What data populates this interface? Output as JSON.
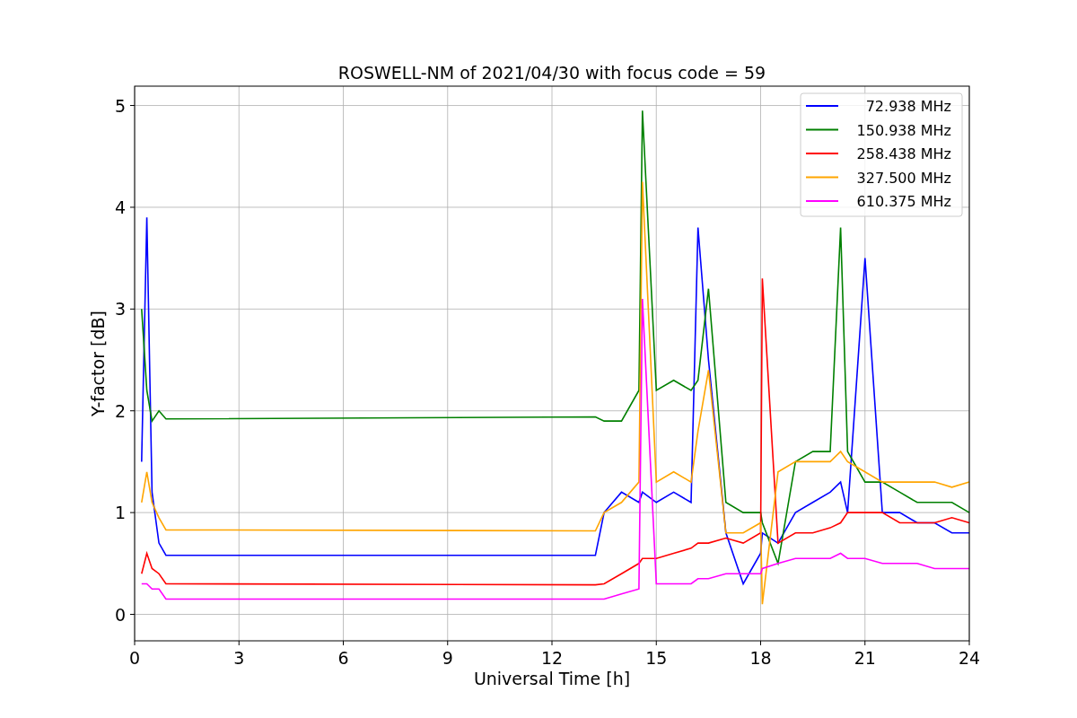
{
  "figure": {
    "chart_data": {
      "type": "line",
      "title": "ROSWELL-NM of 2021/04/30 with focus code = 59",
      "xlabel": "Universal Time [h]",
      "ylabel": "Y-factor [dB]",
      "x": [
        0.2,
        0.35,
        0.5,
        0.7,
        0.9,
        13.25,
        13.5,
        14,
        14.5,
        14.6,
        15,
        15.5,
        16,
        16.2,
        16.5,
        17,
        17.5,
        18,
        18.05,
        18.5,
        19,
        19.5,
        20,
        20.3,
        20.5,
        21,
        21.5,
        22,
        22.5,
        23,
        23.5,
        24
      ],
      "series": [
        {
          "name": "72.938 MHz",
          "color": "#0000ff",
          "values": [
            1.5,
            3.9,
            1.2,
            0.7,
            0.58,
            0.58,
            1.0,
            1.2,
            1.1,
            1.2,
            1.1,
            1.2,
            1.1,
            3.8,
            2.5,
            0.8,
            0.3,
            0.6,
            0.8,
            0.7,
            1.0,
            1.1,
            1.2,
            1.3,
            1.0,
            3.5,
            1.0,
            1.0,
            0.9,
            0.9,
            0.8,
            0.8
          ]
        },
        {
          "name": "150.938 MHz",
          "color": "#008000",
          "values": [
            3.0,
            2.2,
            1.9,
            2.0,
            1.92,
            1.94,
            1.9,
            1.9,
            2.2,
            4.95,
            2.2,
            2.3,
            2.2,
            2.3,
            3.2,
            1.1,
            1.0,
            1.0,
            0.9,
            0.5,
            1.5,
            1.6,
            1.6,
            3.8,
            1.6,
            1.3,
            1.3,
            1.2,
            1.1,
            1.1,
            1.1,
            1.0
          ]
        },
        {
          "name": "258.438 MHz",
          "color": "#ff0000",
          "values": [
            0.4,
            0.6,
            0.45,
            0.4,
            0.3,
            0.29,
            0.3,
            0.4,
            0.5,
            0.55,
            0.55,
            0.6,
            0.65,
            0.7,
            0.7,
            0.75,
            0.7,
            0.8,
            3.3,
            0.7,
            0.8,
            0.8,
            0.85,
            0.9,
            1.0,
            1.0,
            1.0,
            0.9,
            0.9,
            0.9,
            0.95,
            0.9
          ]
        },
        {
          "name": "327.500 MHz",
          "color": "#ffa500",
          "values": [
            1.1,
            1.4,
            1.1,
            0.95,
            0.83,
            0.82,
            1.0,
            1.1,
            1.3,
            4.25,
            1.3,
            1.4,
            1.3,
            1.8,
            2.4,
            0.8,
            0.8,
            0.9,
            0.1,
            1.4,
            1.5,
            1.5,
            1.5,
            1.6,
            1.5,
            1.4,
            1.3,
            1.3,
            1.3,
            1.3,
            1.25,
            1.3
          ]
        },
        {
          "name": "610.375 MHz",
          "color": "#ff00ff",
          "values": [
            0.3,
            0.3,
            0.25,
            0.25,
            0.15,
            0.15,
            0.15,
            0.2,
            0.25,
            3.1,
            0.3,
            0.3,
            0.3,
            0.35,
            0.35,
            0.4,
            0.4,
            0.4,
            0.45,
            0.5,
            0.55,
            0.55,
            0.55,
            0.6,
            0.55,
            0.55,
            0.5,
            0.5,
            0.5,
            0.45,
            0.45,
            0.45
          ]
        }
      ],
      "xlim": [
        0,
        24
      ],
      "ylim": [
        -0.26,
        5.19
      ],
      "xticks": [
        0,
        3,
        6,
        9,
        12,
        15,
        18,
        21,
        24
      ],
      "yticks": [
        0,
        1,
        2,
        3,
        4,
        5
      ],
      "grid": true,
      "legend": "upper right"
    }
  }
}
